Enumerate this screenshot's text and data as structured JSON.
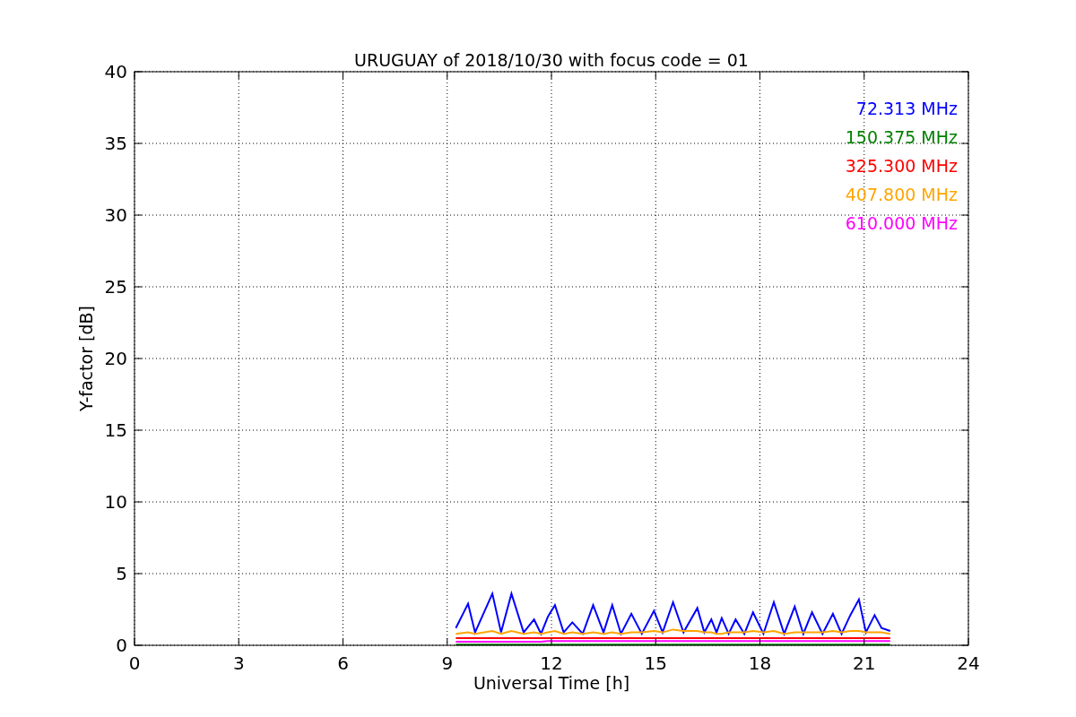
{
  "chart_data": {
    "type": "line",
    "title": "URUGUAY of 2018/10/30 with focus code = 01",
    "xlabel": "Universal Time [h]",
    "ylabel": "Y-factor [dB]",
    "x": [
      9.25,
      9.6,
      9.8,
      10.3,
      10.55,
      10.85,
      11.2,
      11.5,
      11.7,
      11.9,
      12.1,
      12.35,
      12.6,
      12.9,
      13.2,
      13.5,
      13.75,
      14.0,
      14.3,
      14.6,
      14.95,
      15.2,
      15.5,
      15.8,
      16.2,
      16.4,
      16.6,
      16.75,
      16.9,
      17.1,
      17.3,
      17.55,
      17.8,
      18.1,
      18.4,
      18.7,
      19.0,
      19.25,
      19.5,
      19.8,
      20.1,
      20.35,
      20.6,
      20.85,
      21.05,
      21.3,
      21.5,
      21.75
    ],
    "series": [
      {
        "name": "72.313 MHz",
        "color": "#0000ff",
        "values": [
          1.2,
          2.9,
          0.9,
          3.6,
          0.9,
          3.6,
          0.9,
          1.8,
          0.8,
          2.0,
          2.8,
          0.9,
          1.6,
          0.8,
          2.8,
          0.9,
          2.8,
          0.8,
          2.2,
          0.8,
          2.4,
          0.9,
          3.0,
          0.9,
          2.6,
          0.9,
          1.8,
          0.9,
          1.9,
          0.8,
          1.8,
          0.8,
          2.3,
          0.8,
          3.0,
          0.8,
          2.7,
          0.8,
          2.3,
          0.8,
          2.2,
          0.8,
          2.1,
          3.2,
          0.9,
          2.1,
          1.2,
          1.0
        ]
      },
      {
        "name": "150.375 MHz",
        "color": "#008000",
        "values": [
          0.05,
          0.05,
          0.05,
          0.05,
          0.05,
          0.05,
          0.05,
          0.05,
          0.05,
          0.05,
          0.05,
          0.05,
          0.05,
          0.05,
          0.05,
          0.05,
          0.05,
          0.05,
          0.05,
          0.05,
          0.05,
          0.05,
          0.05,
          0.05,
          0.05,
          0.05,
          0.05,
          0.05,
          0.05,
          0.05,
          0.05,
          0.05,
          0.05,
          0.05,
          0.05,
          0.05,
          0.05,
          0.05,
          0.05,
          0.05,
          0.05,
          0.05,
          0.05,
          0.05,
          0.05,
          0.05,
          0.05,
          0.05
        ]
      },
      {
        "name": "325.300 MHz",
        "color": "#ff0000",
        "values": [
          0.5,
          0.5,
          0.5,
          0.5,
          0.5,
          0.5,
          0.5,
          0.5,
          0.5,
          0.5,
          0.5,
          0.5,
          0.5,
          0.5,
          0.5,
          0.5,
          0.5,
          0.5,
          0.5,
          0.5,
          0.5,
          0.5,
          0.5,
          0.5,
          0.5,
          0.5,
          0.5,
          0.5,
          0.5,
          0.5,
          0.5,
          0.5,
          0.5,
          0.5,
          0.5,
          0.5,
          0.5,
          0.5,
          0.5,
          0.5,
          0.5,
          0.5,
          0.5,
          0.5,
          0.5,
          0.5,
          0.5,
          0.5
        ]
      },
      {
        "name": "407.800 MHz",
        "color": "#ffa500",
        "values": [
          0.8,
          0.9,
          0.8,
          1.0,
          0.8,
          1.0,
          0.8,
          0.9,
          0.8,
          0.9,
          1.0,
          0.8,
          0.9,
          0.8,
          0.9,
          0.8,
          0.9,
          0.8,
          0.9,
          0.9,
          1.0,
          0.9,
          1.1,
          1.0,
          1.0,
          0.9,
          0.9,
          0.8,
          0.8,
          0.9,
          0.9,
          0.9,
          1.0,
          0.9,
          1.0,
          0.8,
          0.9,
          0.9,
          0.9,
          0.9,
          1.0,
          0.9,
          1.0,
          1.0,
          0.9,
          0.9,
          0.9,
          0.8
        ]
      },
      {
        "name": "610.000 MHz",
        "color": "#ff00ff",
        "values": [
          0.25,
          0.25,
          0.25,
          0.25,
          0.25,
          0.25,
          0.25,
          0.25,
          0.25,
          0.3,
          0.3,
          0.3,
          0.3,
          0.3,
          0.3,
          0.3,
          0.3,
          0.3,
          0.3,
          0.3,
          0.3,
          0.3,
          0.3,
          0.3,
          0.3,
          0.3,
          0.3,
          0.3,
          0.3,
          0.3,
          0.3,
          0.3,
          0.3,
          0.3,
          0.3,
          0.3,
          0.3,
          0.3,
          0.3,
          0.3,
          0.3,
          0.3,
          0.3,
          0.3,
          0.3,
          0.3,
          0.3,
          0.3
        ]
      }
    ],
    "xlim": [
      0,
      24
    ],
    "ylim": [
      0,
      40
    ],
    "xticks": [
      0,
      3,
      6,
      9,
      12,
      15,
      18,
      21,
      24
    ],
    "yticks": [
      0,
      5,
      10,
      15,
      20,
      25,
      30,
      35,
      40
    ],
    "grid": true
  }
}
